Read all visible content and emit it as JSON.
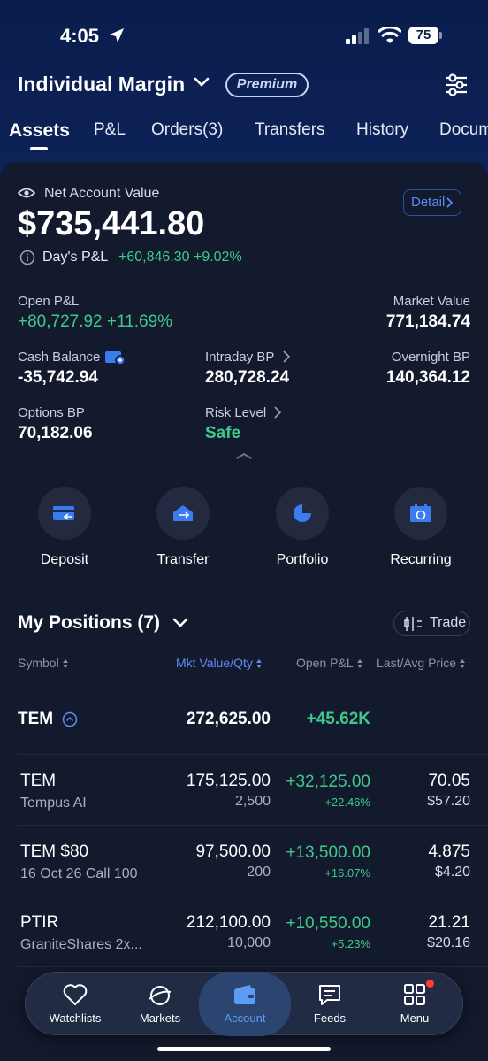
{
  "status": {
    "time": "4:05",
    "battery": "75"
  },
  "header": {
    "account_name": "Individual Margin",
    "badge": "Premium"
  },
  "tabs": [
    {
      "label": "Assets"
    },
    {
      "label": "P&L"
    },
    {
      "label": "Orders(3)"
    },
    {
      "label": "Transfers"
    },
    {
      "label": "History"
    },
    {
      "label": "Docum"
    }
  ],
  "summary": {
    "nav_label": "Net Account Value",
    "nav_value": "$735,441.80",
    "detail_label": "Detail",
    "days_pl_label": "Day's P&L",
    "days_pl_value": "+60,846.30 +9.02%",
    "open_pl_label": "Open P&L",
    "open_pl_value": "+80,727.92 +11.69%",
    "market_value_label": "Market Value",
    "market_value": "771,184.74",
    "cash_balance_label": "Cash Balance",
    "cash_balance": "-35,742.94",
    "intraday_bp_label": "Intraday BP",
    "intraday_bp": "280,728.24",
    "overnight_bp_label": "Overnight BP",
    "overnight_bp": "140,364.12",
    "options_bp_label": "Options BP",
    "options_bp": "70,182.06",
    "risk_level_label": "Risk Level",
    "risk_level": "Safe"
  },
  "actions": [
    {
      "label": "Deposit",
      "icon": "deposit-icon"
    },
    {
      "label": "Transfer",
      "icon": "transfer-icon"
    },
    {
      "label": "Portfolio",
      "icon": "pie-chart-icon"
    },
    {
      "label": "Recurring",
      "icon": "recurring-icon"
    }
  ],
  "positions": {
    "title": "My Positions (7)",
    "trade_label": "Trade",
    "columns": [
      "Symbol",
      "Mkt Value/Qty",
      "Open P&L",
      "Last/Avg Price"
    ],
    "group": {
      "symbol": "TEM",
      "mkt_value": "272,625.00",
      "open_pl": "+45.62K"
    },
    "rows": [
      {
        "symbol": "TEM",
        "name": "Tempus AI",
        "mkt_value": "175,125.00",
        "qty": "2,500",
        "open_pl": "+32,125.00",
        "open_pl_pct": "+22.46%",
        "last": "70.05",
        "avg": "$57.20"
      },
      {
        "symbol": "TEM $80",
        "name": "16 Oct 26 Call 100",
        "mkt_value": "97,500.00",
        "qty": "200",
        "open_pl": "+13,500.00",
        "open_pl_pct": "+16.07%",
        "last": "4.875",
        "avg": "$4.20"
      },
      {
        "symbol": "PTIR",
        "name": "GraniteShares 2x...",
        "mkt_value": "212,100.00",
        "qty": "10,000",
        "open_pl": "+10,550.00",
        "open_pl_pct": "+5.23%",
        "last": "21.21",
        "avg": "$20.16"
      }
    ]
  },
  "bottom_nav": [
    {
      "label": "Watchlists",
      "icon": "heart-icon"
    },
    {
      "label": "Markets",
      "icon": "planet-icon"
    },
    {
      "label": "Account",
      "icon": "wallet-icon"
    },
    {
      "label": "Feeds",
      "icon": "chat-icon"
    },
    {
      "label": "Menu",
      "icon": "grid-icon"
    }
  ],
  "colors": {
    "accent": "#5b8cf5",
    "positive": "#3ec98a",
    "background": "#141a2e",
    "header": "#0d2258"
  }
}
